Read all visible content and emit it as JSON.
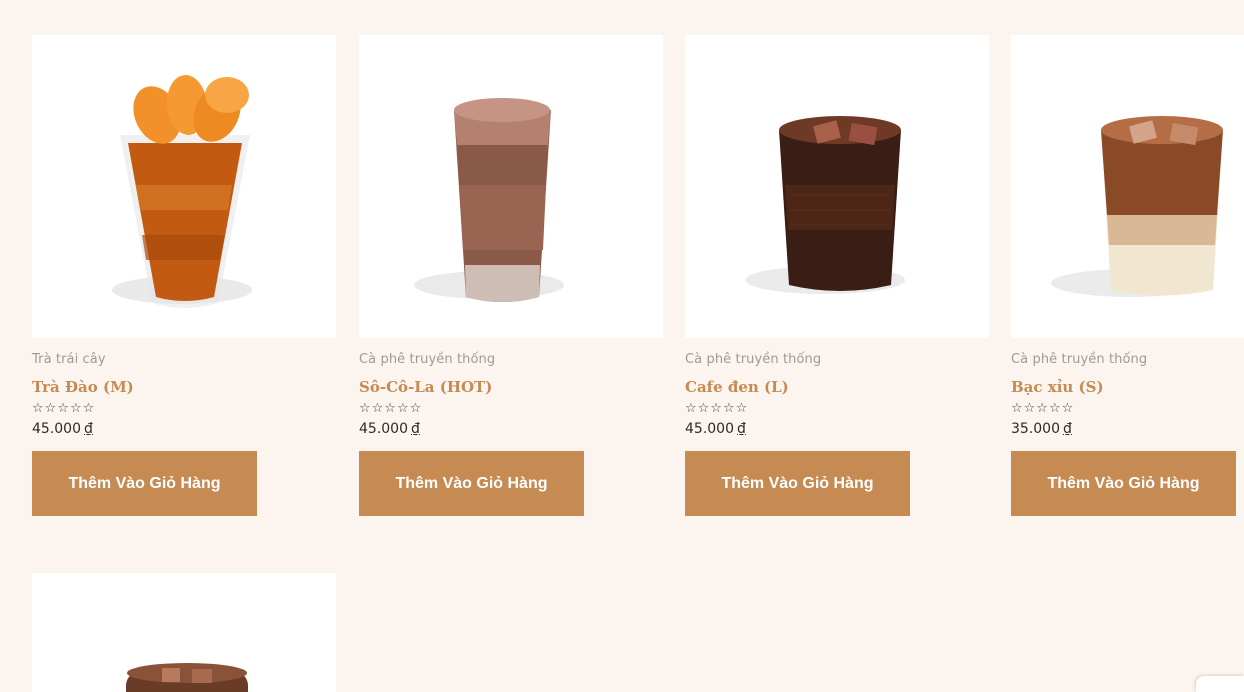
{
  "products": [
    {
      "category": "Trà trái cây",
      "name": "Trà Đào (M)",
      "rating_stars": "☆☆☆☆☆",
      "price": "45.000",
      "currency": "₫",
      "button_label": "Thêm Vào Giỏ Hàng",
      "image_icon": "peach-tea-cup"
    },
    {
      "category": "Cà phê truyền thống",
      "name": "Sô-Cô-La (HOT)",
      "rating_stars": "☆☆☆☆☆",
      "price": "45.000",
      "currency": "₫",
      "button_label": "Thêm Vào Giỏ Hàng",
      "image_icon": "chocolate-drink-glass"
    },
    {
      "category": "Cà phê truyền thống",
      "name": "Cafe đen (L)",
      "rating_stars": "☆☆☆☆☆",
      "price": "45.000",
      "currency": "₫",
      "button_label": "Thêm Vào Giỏ Hàng",
      "image_icon": "black-coffee-glass"
    },
    {
      "category": "Cà phê truyền thống",
      "name": "Bạc xỉu (S)",
      "rating_stars": "☆☆☆☆☆",
      "price": "35.000",
      "currency": "₫",
      "button_label": "Thêm Vào Giỏ Hàng",
      "image_icon": "bac-xiu-glass"
    }
  ],
  "fifth_product": {
    "image_icon": "iced-coffee-glass"
  },
  "colors": {
    "page_bg": "#fcf4ee",
    "accent": "#c68a53",
    "category_text": "#9b9b9b"
  }
}
